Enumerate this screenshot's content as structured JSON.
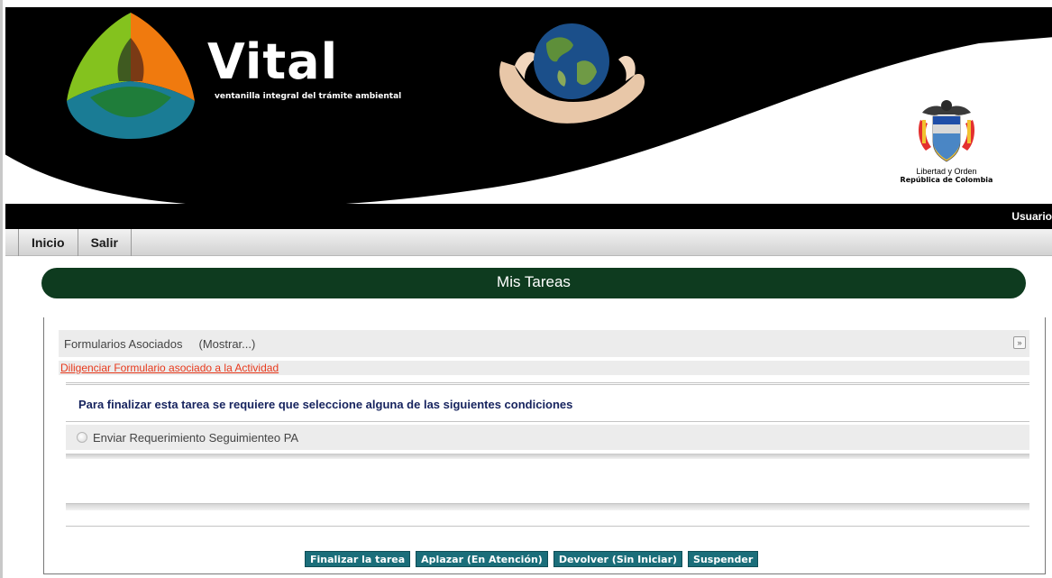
{
  "header": {
    "brand_title": "Vital",
    "brand_subtitle": "ventanilla integral del trámite ambiental",
    "crest_motto": "Libertad y Orden",
    "crest_country": "República de Colombia"
  },
  "userbar": {
    "user_label": "Usuario"
  },
  "nav": {
    "items": [
      {
        "label": "Inicio"
      },
      {
        "label": "Salir"
      }
    ]
  },
  "page": {
    "title": "Mis Tareas"
  },
  "forms": {
    "label": "Formularios Asociados",
    "toggle": "(Mostrar...)",
    "fill_link": "Diligenciar Formulario asociado a la Actividad"
  },
  "conditions": {
    "title": "Para finalizar esta tarea se requiere que seleccione alguna de las siguientes condiciones",
    "options": [
      {
        "label": "Enviar Requerimiento Seguimienteo PA",
        "selected": false
      }
    ]
  },
  "actions": {
    "finalize": "Finalizar la tarea",
    "postpone": "Aplazar (En Atención)",
    "return": "Devolver (Sin Iniciar)",
    "suspend": "Suspender"
  },
  "colors": {
    "title_bar": "#0e3b1f",
    "button": "#1b6e7a",
    "link": "#e8391c",
    "condition_text": "#16235e"
  }
}
